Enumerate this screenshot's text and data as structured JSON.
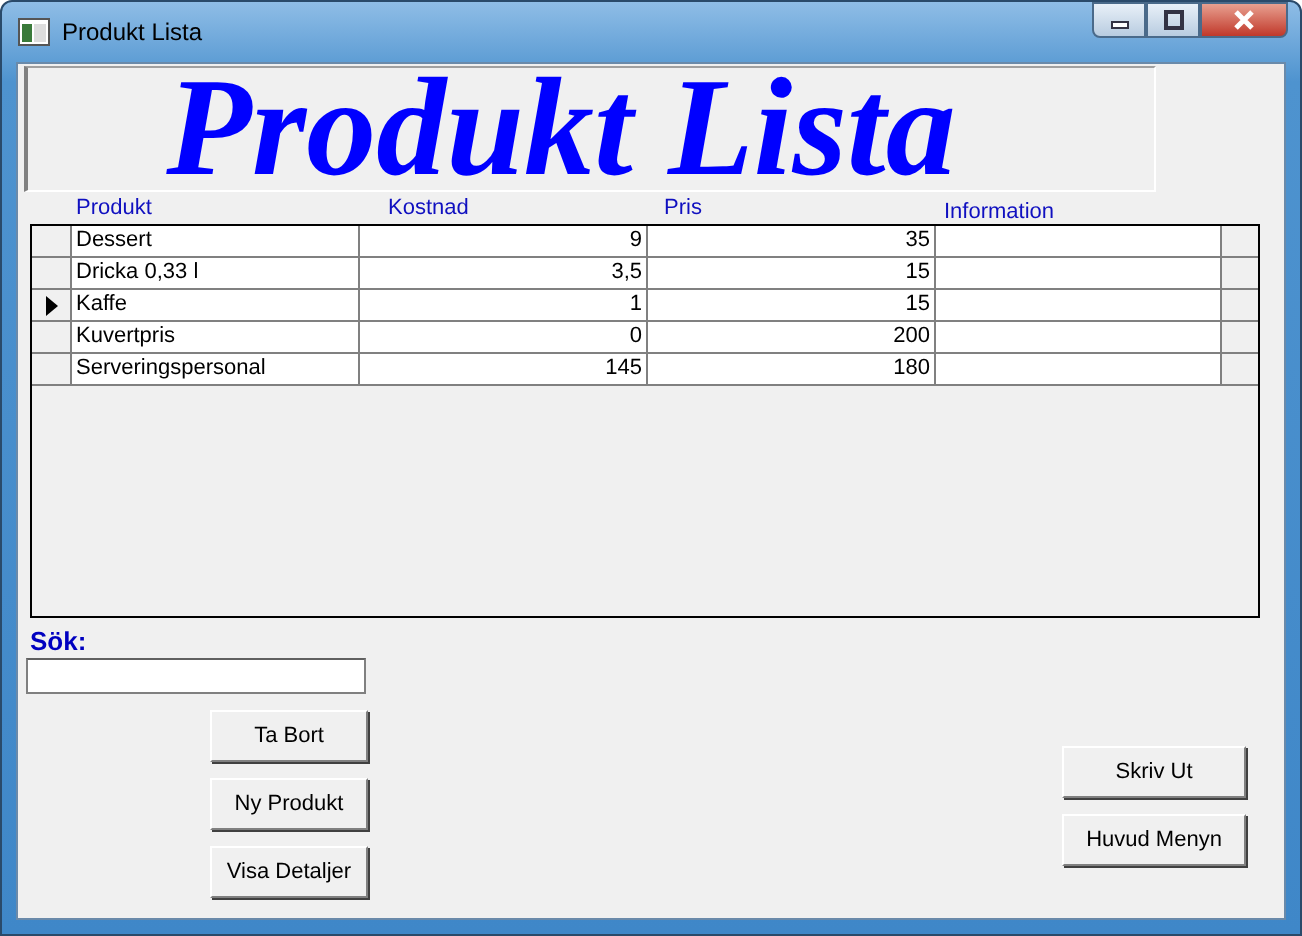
{
  "window": {
    "title": "Produkt Lista"
  },
  "banner": {
    "title": "Produkt Lista"
  },
  "table": {
    "columns": [
      "Produkt",
      "Kostnad",
      "Pris",
      "Information"
    ],
    "rows": [
      {
        "selected": false,
        "cells": [
          "Dessert",
          "9",
          "35",
          ""
        ]
      },
      {
        "selected": false,
        "cells": [
          "Dricka 0,33 l",
          "3,5",
          "15",
          ""
        ]
      },
      {
        "selected": true,
        "cells": [
          "Kaffe",
          "1",
          "15",
          ""
        ]
      },
      {
        "selected": false,
        "cells": [
          "Kuvertpris",
          "0",
          "200",
          ""
        ]
      },
      {
        "selected": false,
        "cells": [
          "Serveringspersonal",
          "145",
          "180",
          ""
        ]
      }
    ]
  },
  "search": {
    "label": "Sök:"
  },
  "left_buttons": [
    "Ta Bort",
    "Ny Produkt",
    "Visa Detaljer"
  ],
  "right_buttons": [
    "Skriv Ut",
    "Huvud Menyn"
  ]
}
